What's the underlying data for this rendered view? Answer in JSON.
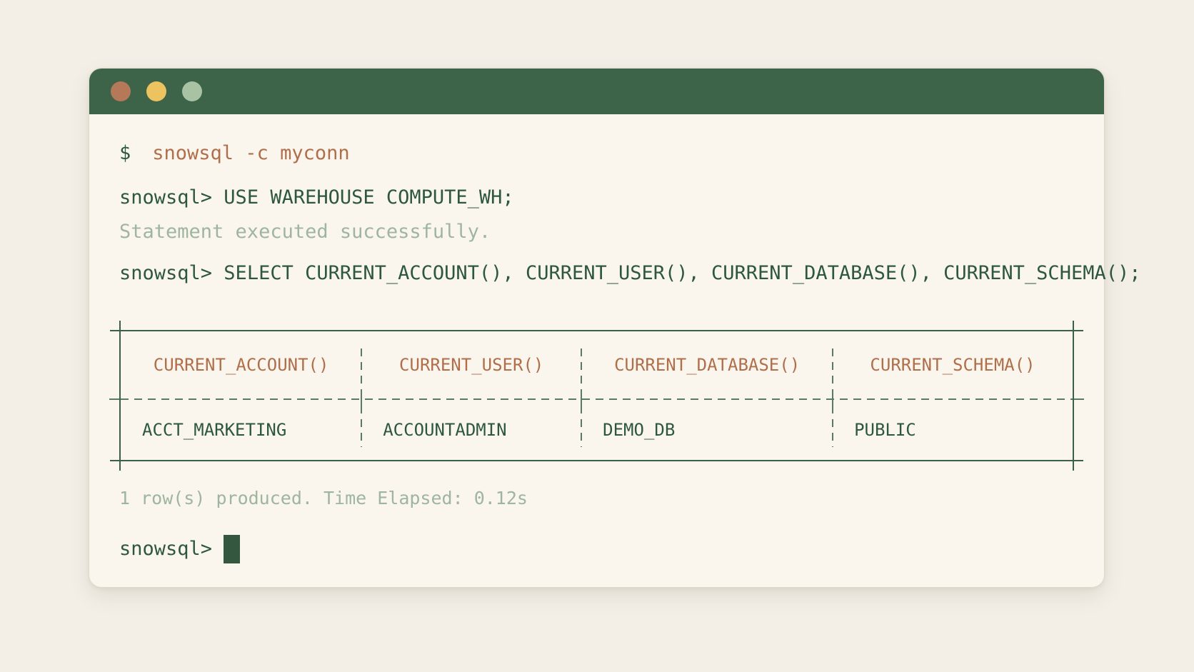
{
  "colors": {
    "page_bg": "#f3efe7",
    "window_bg": "#faf6ee",
    "titlebar_green": "#3d6349",
    "dot_close": "#b5795a",
    "dot_minimize": "#ecc35e",
    "dot_maximize": "#a9c2a4",
    "text_green_dark": "#2e573f",
    "text_sage_muted": "#9fb5a0",
    "text_terracotta": "#b06f4b",
    "table_border_green": "#3a6048",
    "table_dash_green": "#587b61",
    "cursor_green": "#33573f"
  },
  "terminal": {
    "shell": {
      "prompt": "$",
      "command": "snowsql -c myconn"
    },
    "use_line": {
      "prompt": "snowsql>",
      "command": " USE WAREHOUSE COMPUTE_WH;"
    },
    "use_result": "Statement executed successfully.",
    "select_line": {
      "prompt": "snowsql>",
      "command": " SELECT CURRENT_ACCOUNT(), CURRENT_USER(), CURRENT_DATABASE(), CURRENT_SCHEMA();"
    },
    "table": {
      "columns": [
        "CURRENT_ACCOUNT()",
        "CURRENT_USER()",
        "CURRENT_DATABASE()",
        "CURRENT_SCHEMA()"
      ],
      "rows": [
        [
          "ACCT_MARKETING",
          "ACCOUNTADMIN",
          "DEMO_DB",
          "PUBLIC"
        ]
      ]
    },
    "status": "1 row(s) produced. Time Elapsed: 0.12s",
    "idle_prompt": "snowsql>"
  }
}
